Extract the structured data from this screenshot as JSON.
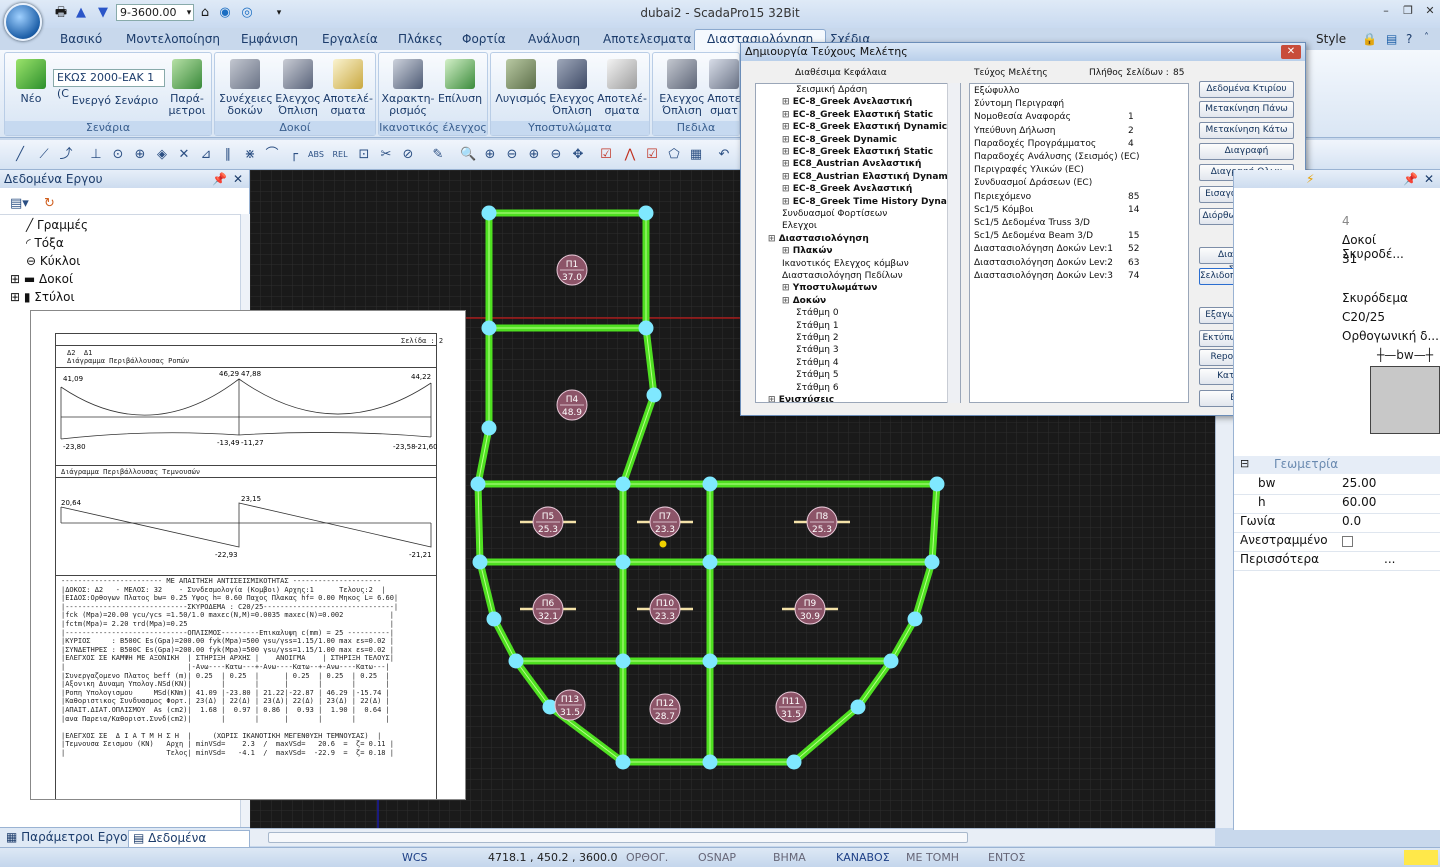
{
  "window": {
    "title": "dubai2 - ScadaPro15 32Bit",
    "scenario_combo": "9-3600.00"
  },
  "tabs": [
    "Βασικό",
    "Μοντελοποίηση",
    "Εμφάνιση",
    "Εργαλεία",
    "Πλάκες",
    "Φορτία",
    "Ανάλυση",
    "Αποτελεσματα",
    "Διαστασιολόγηση",
    "Σχέδια"
  ],
  "style_menu": "Style",
  "ribbon": {
    "scenario_select": "ΕΚΩΣ 2000-ΕΑΚ 1 (C",
    "groups": {
      "scenarios": "Σενάρια",
      "beams": "Δοκοί",
      "capacity": "Ικανοτικός έλεγχος",
      "columns": "Υποστυλώματα",
      "footings": "Πεδιλα"
    },
    "btn_new": "Νέο",
    "btn_active": "Ενεργό Σενάριο",
    "btn_params": "Παρά-μετροι",
    "btn_cont_beams": "Συνέχειες δοκών",
    "btn_check": "Ελεγχος Όπλιση",
    "btn_results": "Αποτελέ-σματα",
    "btn_charact": "Χαρακτη-ρισμός",
    "btn_solve": "Επίλυση",
    "btn_reinf": "Λυγισμός",
    "btn_col_check": "Ελεγχος Όπλιση",
    "btn_col_res": "Αποτελέ-σματα",
    "btn_foot_check": "Ελεγχος Όπλιση",
    "btn_foot_res": "Αποτε σματ"
  },
  "left_panel": {
    "title": "Δεδομένα Εργου",
    "items": [
      "Γραμμές",
      "Τόξα",
      "Κύκλοι",
      "Δοκοί",
      "Στύλοι"
    ],
    "tab1": "Παράμετροι Εργου",
    "tab2": "Δεδομένα Εργου"
  },
  "report": {
    "page": "Σελίδα : 2",
    "title1": "Δ2  Δ1",
    "subtitle1": "Διάγραμμα Περιβάλλουσας Ροπών",
    "m_vals": [
      "41,09",
      "46,29",
      "47,88",
      "44,22",
      "-23,80",
      "-13,49",
      "-11,27",
      "-23,58",
      "-21,60"
    ],
    "subtitle2": "Διάγραμμα Περιβάλλουσας Τεμνουσών",
    "v_vals": [
      "20,64",
      "23,15",
      "-22,93",
      "-21,21"
    ],
    "text_lines": [
      "------------------------ ΜΕ ΑΠΑΙΤΗΣΗ ΑΝΤΙΣΕΙΣΜΙΚΟΤΗΤΑΣ ---------------------",
      "|ΔΟΚΟΣ: Δ2   - ΜΕΛΟΣ: 32    - Συνδεσμολογία (Κομβοι) Αρχης:1      Τελους:2  |",
      "|ΕΙΔΟΣ:Ορθογων Πλατος bw= 0.25 Υψος h= 0.60 Παχος Πλακας hf= 0.00 Μηκος L= 6.60|",
      "|-----------------------------ΣΚΥΡΟΔΕΜΑ : C20/25-------------------------------|",
      "|fck (Mpa)=20.00 γcu/γcs =1.50/1.0 maxεc(N,M)=0.0035 maxεc(N)=0.002           |",
      "|fctm(Mpa)= 2.20 τrd(Mpa)=0.25                                                |",
      "|-----------------------------ΟΠΛΙΣΜΟΣ---------Επικαλυψη c(mm) = 25 ----------|",
      "|ΚΥΡΙΟΣ     : B500C Es(Gpa)=200.00 fyk(Mpa)=500 γsu/γss=1.15/1.00 max εs=0.02 |",
      "|ΣΥΝΔΕΤΗΡΕΣ : B500C Es(Gpa)=200.00 fyk(Mpa)=500 γsu/γss=1.15/1.00 max εs=0.02 |",
      "|ΕΛΕΓΧΟΣ ΣΕ ΚΑΜΨΗ ΜΕ ΑΞΟΝΙΚΗ  | ΣΤΗΡΙΞΗ ΑΡΧΗΣ |    ΑΝΟΙΓΜΑ    | ΣΤΗΡΙΞΗ ΤΕΛΟΥΣ|",
      "|                             |-Ανω----Κατω---+-Ανω----Κατω--+-Ανω----Κατω---|",
      "|Συνεργαζομενο Πλατος beff (m)| 0.25  | 0.25  |      | 0.25  | 0.25  | 0.25  |",
      "|Αξονικη Δυναμη Υπολογ.NSd(KN)|       |       |      |       |       |       |",
      "|Ροπη Υπολογισμου     MSd(KNm)| 41.09 |-23.80 | 21.22|-22.87 | 46.29 |-15.74 |",
      "|Καθοριστικος Συνδυασμος Φορτ.| 23(Δ) | 22(Δ) | 23(Δ)| 22(Δ) | 23(Δ) | 22(Δ) |",
      "|ΑΠΑΙΤ.ΔΙΑΤ.ΟΠΛΙΣΜΟΥ  As (cm2)|  1.68 |  0.97 | 0.86 |  0.93 |  1.90 |  0.64 |",
      "|ανα Παρεια/Καθοριστ.Συνδ(cm2)|       |       |      |       |       |       |",
      "",
      "|ΕΛΕΓΧΟΣ ΣΕ  Δ Ι Α Τ Μ Η Σ Η  |     (ΧΩΡΙΣ ΙΚΑΝΟΤΙΚΗ ΜΕΓΕΝΘΥΣΗ ΤΕΜΝΟΥΣΑΣ)  |",
      "|Τεμνουσα Σεισμου (KN)   Αρχη | minVSd=    2.3  /  maxVSd=   20.6  =  ζ= 0.11 |",
      "|                        Τελος| minVSd=   -4.1  /  maxVSd=  -22.9  =  ζ= 0.18 |"
    ]
  },
  "dialog": {
    "title": "Δημιουργία Τεύχους Μελέτης",
    "col1": "Διαθέσιμα Κεφάλαια",
    "col2": "Τεύχος Μελέτης",
    "col3": "Πλήθος Σελίδων :",
    "total_pages": "85",
    "tree": [
      {
        "t": "Σεισμική Δράση",
        "l": 3,
        "b": false
      },
      {
        "t": "EC-8_Greek Ανελαστική",
        "l": 2,
        "b": true
      },
      {
        "t": "EC-8_Greek Ελαστική Static",
        "l": 2,
        "b": true
      },
      {
        "t": "EC-8_Greek Ελαστική Dynamic",
        "l": 2,
        "b": true
      },
      {
        "t": "EC-8_Greek Dynamic",
        "l": 2,
        "b": true
      },
      {
        "t": "EC-8_Greek Ελαστική Static",
        "l": 2,
        "b": true
      },
      {
        "t": "EC8_Austrian Ανελαστική",
        "l": 2,
        "b": true
      },
      {
        "t": "EC8_Austrian Ελαστική Dynamic",
        "l": 2,
        "b": true
      },
      {
        "t": "EC-8_Greek Ανελαστική",
        "l": 2,
        "b": true
      },
      {
        "t": "EC-8_Greek Time History Dynamic",
        "l": 2,
        "b": true
      },
      {
        "t": "Συνδυασμοί Φορτίσεων",
        "l": 2,
        "b": false
      },
      {
        "t": "Ελεγχοι",
        "l": 2,
        "b": false
      },
      {
        "t": "Διαστασιολόγηση",
        "l": 1,
        "b": true
      },
      {
        "t": "Πλακών",
        "l": 2,
        "b": true
      },
      {
        "t": "Ικανοτικός Ελεγχος κόμβων",
        "l": 2,
        "b": false
      },
      {
        "t": "Διαστασιολόγηση Πεδίλων",
        "l": 2,
        "b": false
      },
      {
        "t": "Υποστυλωμάτων",
        "l": 2,
        "b": true
      },
      {
        "t": "Δοκών",
        "l": 2,
        "b": true
      },
      {
        "t": "Στάθμη 0",
        "l": 3,
        "b": false
      },
      {
        "t": "Στάθμη 1",
        "l": 3,
        "b": false
      },
      {
        "t": "Στάθμη 2",
        "l": 3,
        "b": false
      },
      {
        "t": "Στάθμη 3",
        "l": 3,
        "b": false
      },
      {
        "t": "Στάθμη 4",
        "l": 3,
        "b": false
      },
      {
        "t": "Στάθμη 5",
        "l": 3,
        "b": false
      },
      {
        "t": "Στάθμη 6",
        "l": 3,
        "b": false
      },
      {
        "t": "Ενισχύσεις",
        "l": 1,
        "b": true
      }
    ],
    "list": [
      {
        "n": "Εξώφυλλο",
        "p": ""
      },
      {
        "n": "Σύντομη Περιγραφή",
        "p": ""
      },
      {
        "n": "Νομοθεσία Αναφοράς",
        "p": "1"
      },
      {
        "n": "Υπεύθυνη Δήλωση",
        "p": "2"
      },
      {
        "n": "Παραδοχές Προγράμματος",
        "p": "4"
      },
      {
        "n": "Παραδοχές Ανάλυσης (Σεισμός) (EC)",
        "p": ""
      },
      {
        "n": "Περιγραφές Υλικών (EC)",
        "p": ""
      },
      {
        "n": "Συνδυασμοί Δράσεων (EC)",
        "p": ""
      },
      {
        "n": "Περιεχόμενο",
        "p": "85"
      },
      {
        "n": "Sc1/5 Κόμβοι",
        "p": "14"
      },
      {
        "n": "Sc1/5 Δεδομένα Truss 3/D",
        "p": ""
      },
      {
        "n": "Sc1/5 Δεδομένα Beam 3/D",
        "p": "15"
      },
      {
        "n": "Διαστασιολόγηση Δοκών Lev:1",
        "p": "52"
      },
      {
        "n": "Διαστασιολόγηση Δοκών Lev:2",
        "p": "63"
      },
      {
        "n": "Διαστασιολόγηση Δοκών Lev:3",
        "p": "74"
      }
    ],
    "buttons": [
      "Δεδομένα Κτιρίου",
      "Μετακίνηση Πάνω",
      "Μετακίνηση Κάτω",
      "Διαγραφή",
      "Διαγραφή Ολων",
      "Εισαγωγή Αρχείου",
      "Διόρθωση Κειμένου",
      "Διαμόρφωση Σελίδας",
      "Σελιδοποίηση",
      "Εξαγωγή Μελέτης",
      "Εκτύπωση Μελέτης",
      "Report Μελέτης",
      "Καταχώρηση",
      "Εξοδος"
    ],
    "paging_value": "0"
  },
  "right_panel": {
    "rows": [
      {
        "k": "",
        "v": "4"
      },
      {
        "k": "",
        "v": "Δοκοί Σκυροδέ..."
      },
      {
        "k": "",
        "v": "31"
      },
      {
        "k": "",
        "v": "Σκυρόδεμα"
      },
      {
        "k": "",
        "v": "C20/25"
      },
      {
        "k": "",
        "v": "Ορθογωνική  δ..."
      }
    ],
    "bw_label": "bw",
    "geometry_header": "Γεωμετρία",
    "geom": [
      {
        "k": "bw",
        "v": "25.00"
      },
      {
        "k": "h",
        "v": "60.00"
      },
      {
        "k": "Γωνία",
        "v": "0.0"
      },
      {
        "k": "Ανεστραμμένο",
        "v": ""
      },
      {
        "k": "Περισσότερα",
        "v": "..."
      }
    ]
  },
  "slabs": [
    {
      "n": "Π1",
      "v": "37.0"
    },
    {
      "n": "Π4",
      "v": "48.9"
    },
    {
      "n": "Π5",
      "v": "25.3"
    },
    {
      "n": "Π7",
      "v": "23.3"
    },
    {
      "n": "Π8",
      "v": "25.3"
    },
    {
      "n": "Π6",
      "v": "32.1"
    },
    {
      "n": "Π10",
      "v": "23.3"
    },
    {
      "n": "Π9",
      "v": "30.9"
    },
    {
      "n": "Π13",
      "v": "31.5"
    },
    {
      "n": "Π12",
      "v": "28.7"
    },
    {
      "n": "Π11",
      "v": "31.5"
    }
  ],
  "status": {
    "wcs": "WCS",
    "coords": "4718.1 , 450.2 , 3600.0",
    "items": [
      "ΟΡΘΟΓ.",
      "OSNAP",
      "ΒΗΜΑ",
      "ΚΑΝΑΒΟΣ",
      "ΜΕ ΤΟΜΗ",
      "ΕΝΤΟΣ"
    ]
  },
  "colors": {
    "beam": "#4fe021",
    "node": "#7fe8ff",
    "slab": "#8c5468",
    "accent": "#1d3f86"
  }
}
